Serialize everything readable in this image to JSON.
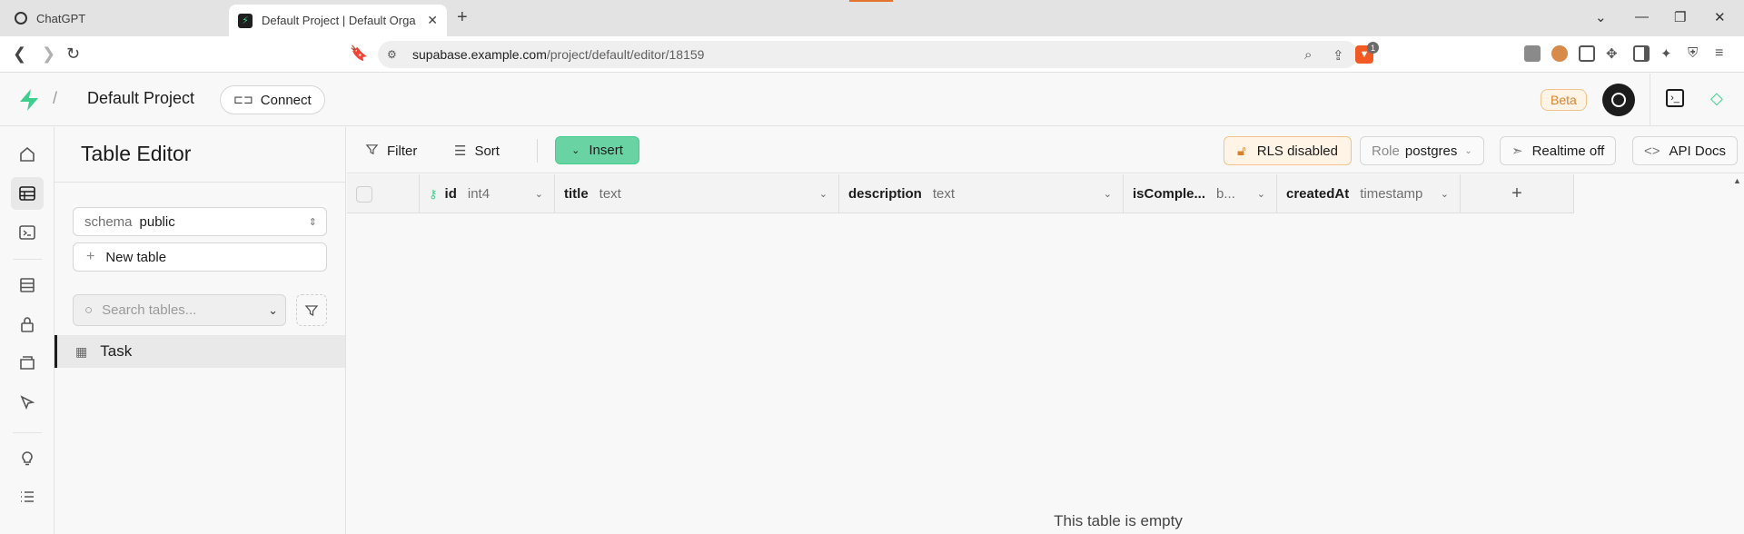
{
  "browser": {
    "tabs": [
      {
        "title": "ChatGPT"
      },
      {
        "title": "Default Project | Default Organization"
      }
    ],
    "url_host": "supabase.example.com",
    "url_path": "/project/default/editor/18159",
    "brave_badge": "1"
  },
  "header": {
    "project_name": "Default Project",
    "connect_label": "Connect",
    "beta_label": "Beta",
    "brand_color": "#3ecf8e"
  },
  "panel": {
    "title": "Table Editor",
    "schema_label": "schema",
    "schema_value": "public",
    "new_table_label": "New table",
    "search_placeholder": "Search tables...",
    "tables": [
      {
        "name": "Task"
      }
    ]
  },
  "toolbar": {
    "filter_label": "Filter",
    "sort_label": "Sort",
    "insert_label": "Insert",
    "rls_label": "RLS disabled",
    "role_label": "Role",
    "role_value": "postgres",
    "realtime_label": "Realtime off",
    "api_docs_label": "API Docs"
  },
  "grid": {
    "columns": [
      {
        "name": "id",
        "type": "int4",
        "primary_key": true
      },
      {
        "name": "title",
        "type": "text"
      },
      {
        "name": "description",
        "type": "text"
      },
      {
        "name": "isComple...",
        "type": "b..."
      },
      {
        "name": "createdAt",
        "type": "timestamp"
      }
    ],
    "empty_message": "This table is empty"
  }
}
